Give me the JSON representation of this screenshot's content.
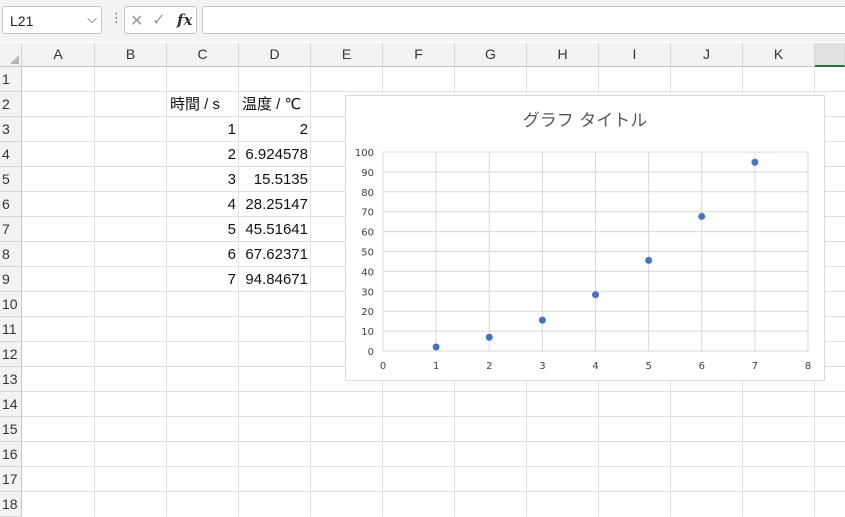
{
  "formula_bar": {
    "name_box": "L21",
    "fx_label": "fx",
    "formula": ""
  },
  "grid": {
    "columns": [
      "A",
      "B",
      "C",
      "D",
      "E",
      "F",
      "G",
      "H",
      "I",
      "J",
      "K"
    ],
    "rows": [
      "1",
      "2",
      "3",
      "4",
      "5",
      "6",
      "7",
      "8",
      "9",
      "10",
      "11",
      "12",
      "13",
      "14",
      "15",
      "16",
      "17",
      "18"
    ]
  },
  "sheet": {
    "header_c": "時間 / s",
    "header_d": "温度 / ℃",
    "rows": [
      {
        "c": "1",
        "d": "2"
      },
      {
        "c": "2",
        "d": "6.924578"
      },
      {
        "c": "3",
        "d": "15.5135"
      },
      {
        "c": "4",
        "d": "28.25147"
      },
      {
        "c": "5",
        "d": "45.51641"
      },
      {
        "c": "6",
        "d": "67.62371"
      },
      {
        "c": "7",
        "d": "94.84671"
      }
    ]
  },
  "chart_data": {
    "type": "scatter",
    "title": "グラフ タイトル",
    "x": [
      1,
      2,
      3,
      4,
      5,
      6,
      7
    ],
    "y": [
      2,
      6.924578,
      15.5135,
      28.25147,
      45.51641,
      67.62371,
      94.84671
    ],
    "xlim": [
      0,
      8
    ],
    "ylim": [
      0,
      100
    ],
    "xticks": [
      "0",
      "1",
      "2",
      "3",
      "4",
      "5",
      "6",
      "7",
      "8"
    ],
    "yticks": [
      "0",
      "10",
      "20",
      "30",
      "40",
      "50",
      "60",
      "70",
      "80",
      "90",
      "100"
    ],
    "grid": true,
    "marker_color": "#4472c4"
  }
}
